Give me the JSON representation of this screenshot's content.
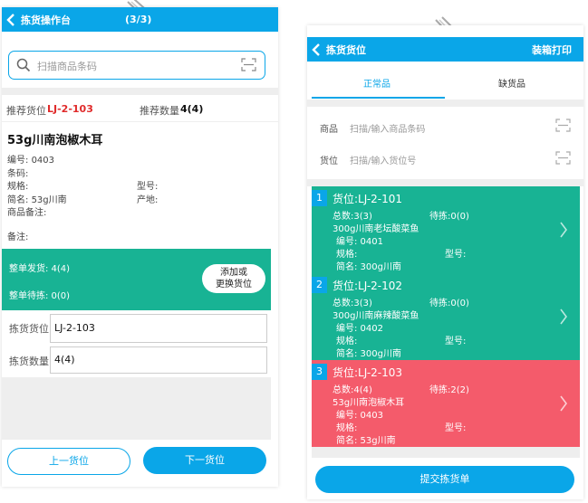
{
  "left": {
    "header": {
      "title": "拣货操作台",
      "counter": "(3/3)"
    },
    "search": {
      "placeholder": "扫描商品条码"
    },
    "recommend": {
      "loc_label": "推荐货位",
      "loc_value": "LJ-2-103",
      "qty_label": "推荐数量",
      "qty_value": "4(4)"
    },
    "product": {
      "name": "53g川南泡椒木耳",
      "code_label": "编号:",
      "code_value": "0403",
      "barcode_label": "条码:",
      "spec_label": "规格:",
      "model_label": "型号:",
      "short_label": "简名:",
      "short_value": "53g川南",
      "origin_label": "产地:",
      "note_label": "商品备注:",
      "remark_label": "备注:"
    },
    "summary": {
      "shipped": "整单发货: 4(4)",
      "pending": "整单待拣: 0(0)",
      "change_button": [
        "添加或",
        "更换货位"
      ]
    },
    "form": {
      "loc_label": "拣货货位",
      "loc_value": "LJ-2-103",
      "qty_label": "拣货数量",
      "qty_value": "4(4)"
    },
    "footer": {
      "prev": "上一货位",
      "next": "下一货位"
    }
  },
  "right": {
    "header": {
      "title": "拣货货位",
      "action": "装箱打印"
    },
    "tabs": [
      {
        "label": "正常品",
        "active": true
      },
      {
        "label": "缺货品",
        "active": false
      }
    ],
    "product_input": {
      "label": "商品",
      "placeholder": "扫描/输入商品条码"
    },
    "location_input": {
      "label": "货位",
      "placeholder": "扫描/输入货位号"
    },
    "cards": [
      {
        "index": "1",
        "location": "货位:LJ-2-101",
        "total": "总数:3(3)",
        "pending": "待拣:0(0)",
        "product": "300g川南老坛酸菜鱼",
        "code": "编号:  0401",
        "spec": "规格:",
        "model": "型号:",
        "short": "简名:   300g川南",
        "status": "done"
      },
      {
        "index": "2",
        "location": "货位:LJ-2-102",
        "total": "总数:3(3)",
        "pending": "待拣:0(0)",
        "product": "300g川南麻辣酸菜鱼",
        "code": "编号:  0402",
        "spec": "规格:",
        "model": "型号:",
        "short": "简名:   300g川南",
        "status": "done"
      },
      {
        "index": "3",
        "location": "货位:LJ-2-103",
        "total": "总数:4(4)",
        "pending": "待拣:2(2)",
        "product": "53g川南泡椒木耳",
        "code": "编号:  0403",
        "spec": "规格:",
        "model": "型号:",
        "short": "简名:   53g川南",
        "status": "pending"
      }
    ],
    "submit": "提交拣货单"
  },
  "colors": {
    "primary": "#0aa6e8",
    "green": "#18b394",
    "red": "#f45b6b",
    "accent_red": "#e02b2b"
  }
}
